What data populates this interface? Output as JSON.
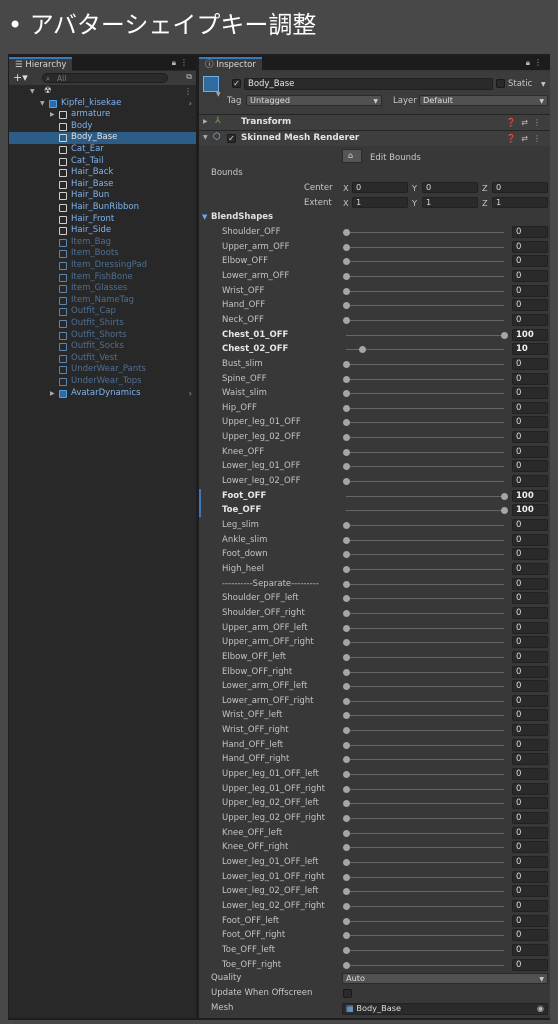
{
  "slide_title": "• アバターシェイプキー調整",
  "hierarchy": {
    "tab_label": "Hierarchy",
    "search_placeholder": "All",
    "plus_label": "+▾",
    "items": [
      {
        "label": "",
        "depth": 0,
        "arrow": "▼",
        "style": "white",
        "icon": "scene-icon"
      },
      {
        "label": "Kipfel_kisekae",
        "depth": 1,
        "arrow": "▼",
        "style": "blue",
        "icon": "prefab-cube-icon",
        "chevron": true
      },
      {
        "label": "armature",
        "depth": 2,
        "arrow": "▶",
        "style": "blue",
        "icon": "cube-icon"
      },
      {
        "label": "Body",
        "depth": 2,
        "arrow": "",
        "style": "blue",
        "icon": "cube-icon"
      },
      {
        "label": "Body_Base",
        "depth": 2,
        "arrow": "",
        "style": "white",
        "icon": "cube-icon",
        "selected": true
      },
      {
        "label": "Cat_Ear",
        "depth": 2,
        "arrow": "",
        "style": "blue",
        "icon": "cube-icon"
      },
      {
        "label": "Cat_Tail",
        "depth": 2,
        "arrow": "",
        "style": "blue",
        "icon": "cube-icon"
      },
      {
        "label": "Hair_Back",
        "depth": 2,
        "arrow": "",
        "style": "blue",
        "icon": "cube-icon"
      },
      {
        "label": "Hair_Base",
        "depth": 2,
        "arrow": "",
        "style": "blue",
        "icon": "cube-icon"
      },
      {
        "label": "Hair_Bun",
        "depth": 2,
        "arrow": "",
        "style": "blue",
        "icon": "cube-icon"
      },
      {
        "label": "Hair_BunRibbon",
        "depth": 2,
        "arrow": "",
        "style": "blue",
        "icon": "cube-icon"
      },
      {
        "label": "Hair_Front",
        "depth": 2,
        "arrow": "",
        "style": "blue",
        "icon": "cube-icon"
      },
      {
        "label": "Hair_Side",
        "depth": 2,
        "arrow": "",
        "style": "blue",
        "icon": "cube-icon"
      },
      {
        "label": "Item_Bag",
        "depth": 2,
        "arrow": "",
        "style": "dim",
        "icon": "cube-icon"
      },
      {
        "label": "Item_Boots",
        "depth": 2,
        "arrow": "",
        "style": "dim",
        "icon": "cube-icon"
      },
      {
        "label": "Item_DressingPad",
        "depth": 2,
        "arrow": "",
        "style": "dim",
        "icon": "cube-icon"
      },
      {
        "label": "Item_FishBone",
        "depth": 2,
        "arrow": "",
        "style": "dim",
        "icon": "cube-icon"
      },
      {
        "label": "Item_Glasses",
        "depth": 2,
        "arrow": "",
        "style": "dim",
        "icon": "cube-icon"
      },
      {
        "label": "Item_NameTag",
        "depth": 2,
        "arrow": "",
        "style": "dim",
        "icon": "cube-icon"
      },
      {
        "label": "Outfit_Cap",
        "depth": 2,
        "arrow": "",
        "style": "dim",
        "icon": "cube-icon"
      },
      {
        "label": "Outfit_Shirts",
        "depth": 2,
        "arrow": "",
        "style": "dim",
        "icon": "cube-icon"
      },
      {
        "label": "Outfit_Shorts",
        "depth": 2,
        "arrow": "",
        "style": "dim",
        "icon": "cube-icon"
      },
      {
        "label": "Outfit_Socks",
        "depth": 2,
        "arrow": "",
        "style": "dim",
        "icon": "cube-icon"
      },
      {
        "label": "Outfit_Vest",
        "depth": 2,
        "arrow": "",
        "style": "dim",
        "icon": "cube-icon"
      },
      {
        "label": "UnderWear_Pants",
        "depth": 2,
        "arrow": "",
        "style": "dim",
        "icon": "cube-icon"
      },
      {
        "label": "UnderWear_Tops",
        "depth": 2,
        "arrow": "",
        "style": "dim",
        "icon": "cube-icon"
      },
      {
        "label": "AvatarDynamics",
        "depth": 2,
        "arrow": "▶",
        "style": "blue",
        "icon": "prefab-cube-icon",
        "chevron": true
      }
    ]
  },
  "inspector": {
    "tab_label": "Inspector",
    "object_name": "Body_Base",
    "static_label": "Static",
    "tag_label": "Tag",
    "tag_value": "Untagged",
    "layer_label": "Layer",
    "layer_value": "Default",
    "transform_title": "Transform",
    "smr_title": "Skinned Mesh Renderer",
    "edit_bounds_label": "Edit Bounds",
    "bounds_label": "Bounds",
    "center_label": "Center",
    "extent_label": "Extent",
    "center": {
      "x": "0",
      "y": "0",
      "z": "0"
    },
    "extent": {
      "x": "1",
      "y": "1",
      "z": "1"
    },
    "axis_x": "X",
    "axis_y": "Y",
    "axis_z": "Z",
    "blendshapes_label": "BlendShapes",
    "blendshapes": [
      {
        "name": "Shoulder_OFF",
        "value": 0
      },
      {
        "name": "Upper_arm_OFF",
        "value": 0
      },
      {
        "name": "Elbow_OFF",
        "value": 0
      },
      {
        "name": "Lower_arm_OFF",
        "value": 0
      },
      {
        "name": "Wrist_OFF",
        "value": 0
      },
      {
        "name": "Hand_OFF",
        "value": 0
      },
      {
        "name": "Neck_OFF",
        "value": 0
      },
      {
        "name": "Chest_01_OFF",
        "value": 100,
        "bold": true
      },
      {
        "name": "Chest_02_OFF",
        "value": 10,
        "bold": true
      },
      {
        "name": "Bust_slim",
        "value": 0
      },
      {
        "name": "Spine_OFF",
        "value": 0
      },
      {
        "name": "Waist_slim",
        "value": 0
      },
      {
        "name": "Hip_OFF",
        "value": 0
      },
      {
        "name": "Upper_leg_01_OFF",
        "value": 0
      },
      {
        "name": "Upper_leg_02_OFF",
        "value": 0
      },
      {
        "name": "Knee_OFF",
        "value": 0
      },
      {
        "name": "Lower_leg_01_OFF",
        "value": 0
      },
      {
        "name": "Lower_leg_02_OFF",
        "value": 0
      },
      {
        "name": "Foot_OFF",
        "value": 100,
        "bold": true,
        "marked": true
      },
      {
        "name": "Toe_OFF",
        "value": 100,
        "bold": true,
        "marked": true
      },
      {
        "name": "Leg_slim",
        "value": 0
      },
      {
        "name": "Ankle_slim",
        "value": 0
      },
      {
        "name": "Foot_down",
        "value": 0
      },
      {
        "name": "High_heel",
        "value": 0
      },
      {
        "name": "----------Separate---------",
        "value": 0
      },
      {
        "name": "Shoulder_OFF_left",
        "value": 0
      },
      {
        "name": "Shoulder_OFF_right",
        "value": 0
      },
      {
        "name": "Upper_arm_OFF_left",
        "value": 0
      },
      {
        "name": "Upper_arm_OFF_right",
        "value": 0
      },
      {
        "name": "Elbow_OFF_left",
        "value": 0
      },
      {
        "name": "Elbow_OFF_right",
        "value": 0
      },
      {
        "name": "Lower_arm_OFF_left",
        "value": 0
      },
      {
        "name": "Lower_arm_OFF_right",
        "value": 0
      },
      {
        "name": "Wrist_OFF_left",
        "value": 0
      },
      {
        "name": "Wrist_OFF_right",
        "value": 0
      },
      {
        "name": "Hand_OFF_left",
        "value": 0
      },
      {
        "name": "Hand_OFF_right",
        "value": 0
      },
      {
        "name": "Upper_leg_01_OFF_left",
        "value": 0
      },
      {
        "name": "Upper_leg_01_OFF_right",
        "value": 0
      },
      {
        "name": "Upper_leg_02_OFF_left",
        "value": 0
      },
      {
        "name": "Upper_leg_02_OFF_right",
        "value": 0
      },
      {
        "name": "Knee_OFF_left",
        "value": 0
      },
      {
        "name": "Knee_OFF_right",
        "value": 0
      },
      {
        "name": "Lower_leg_01_OFF_left",
        "value": 0
      },
      {
        "name": "Lower_leg_01_OFF_right",
        "value": 0
      },
      {
        "name": "Lower_leg_02_OFF_left",
        "value": 0
      },
      {
        "name": "Lower_leg_02_OFF_right",
        "value": 0
      },
      {
        "name": "Foot_OFF_left",
        "value": 0
      },
      {
        "name": "Foot_OFF_right",
        "value": 0
      },
      {
        "name": "Toe_OFF_left",
        "value": 0
      },
      {
        "name": "Toe_OFF_right",
        "value": 0
      }
    ],
    "quality_label": "Quality",
    "quality_value": "Auto",
    "update_offscreen_label": "Update When Offscreen",
    "mesh_label": "Mesh",
    "mesh_value": "Body_Base"
  },
  "colors": {
    "selection": "#2c5d87",
    "accent": "#3a79bb",
    "prefab_blue": "#7fb3ef"
  }
}
